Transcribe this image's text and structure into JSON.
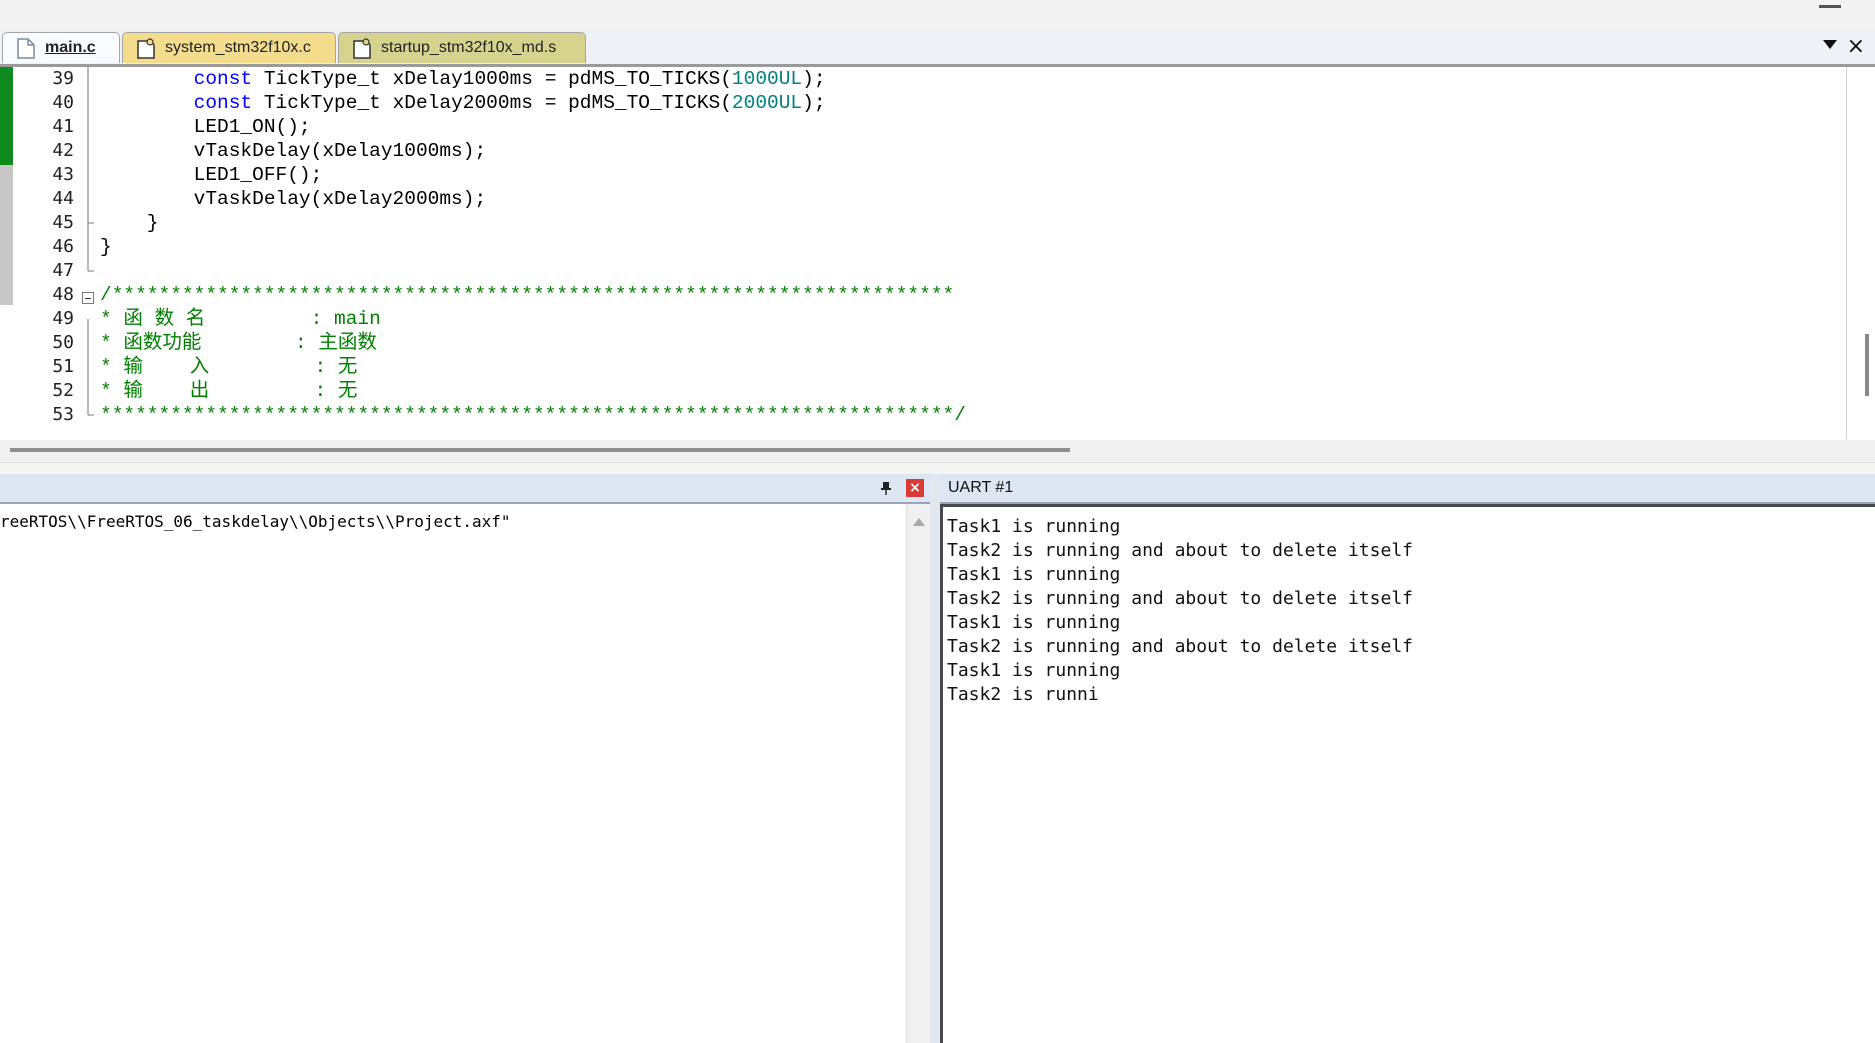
{
  "tabs": [
    {
      "label": "main.c",
      "active": true
    },
    {
      "label": "system_stm32f10x.c",
      "active": false
    },
    {
      "label": "startup_stm32f10x_md.s",
      "active": false
    }
  ],
  "editor": {
    "line_numbers": [
      "39",
      "40",
      "41",
      "42",
      "43",
      "44",
      "45",
      "46",
      "47",
      "48",
      "49",
      "50",
      "51",
      "52",
      "53"
    ],
    "lines": [
      {
        "indent": "        ",
        "kw": "const",
        "a": " TickType_t xDelay1000ms = pdMS_TO_TICKS(",
        "num": "1000UL",
        "b": ");"
      },
      {
        "indent": "        ",
        "kw": "const",
        "a": " TickType_t xDelay2000ms = pdMS_TO_TICKS(",
        "num": "2000UL",
        "b": ");"
      },
      {
        "text": "        LED1_ON();"
      },
      {
        "text": "        vTaskDelay(xDelay1000ms);"
      },
      {
        "text": "        LED1_OFF();"
      },
      {
        "text": "        vTaskDelay(xDelay2000ms);"
      },
      {
        "text": "    }"
      },
      {
        "text": "}"
      },
      {
        "text": ""
      },
      {
        "comment": "/************************************************************************"
      },
      {
        "comment": "* 函 数 名         : main"
      },
      {
        "comment": "* 函数功能        : 主函数"
      },
      {
        "comment": "* 输    入         : 无"
      },
      {
        "comment": "* 输    出         : 无"
      },
      {
        "comment": "*************************************************************************/"
      }
    ]
  },
  "build_output": {
    "line": "reeRTOS\\\\FreeRTOS_06_taskdelay\\\\Objects\\\\Project.axf\""
  },
  "uart": {
    "title": "UART #1",
    "lines": [
      "Task1 is running",
      "Task2 is running and about to delete itself",
      "Task1 is running",
      "Task2 is running and about to delete itself",
      "Task1 is running",
      "Task2 is running and about to delete itself",
      "Task1 is running",
      "Task2 is runni"
    ]
  },
  "icons": {
    "close": "×",
    "panel_close": "×"
  }
}
